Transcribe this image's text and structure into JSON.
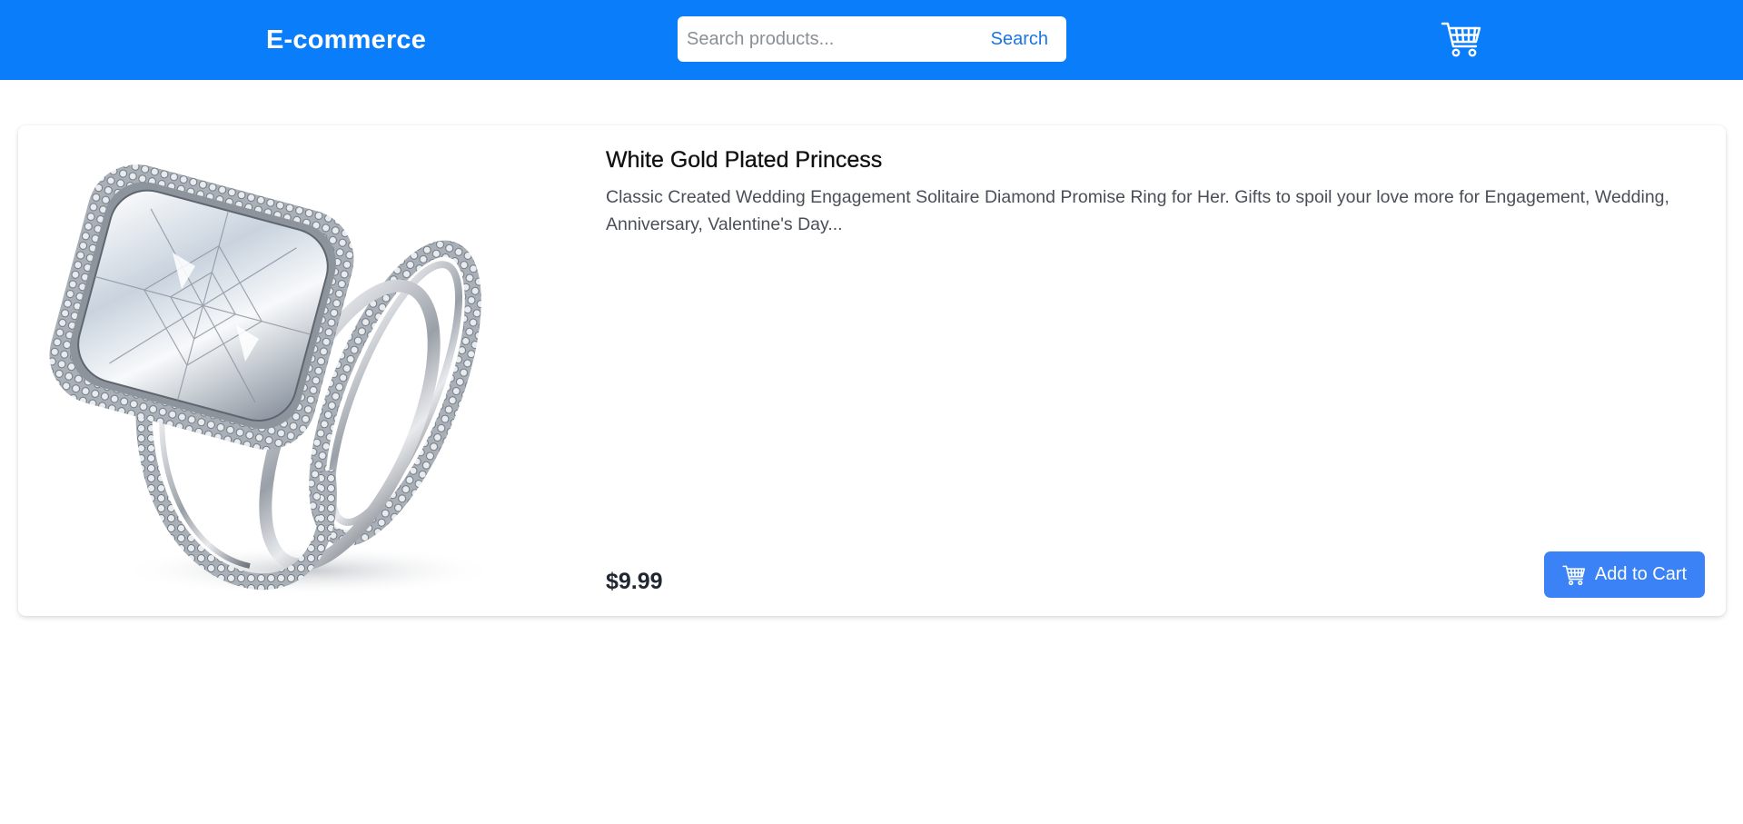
{
  "header": {
    "brand": "E-commerce",
    "search_placeholder": "Search products...",
    "search_label": "Search",
    "cart_icon": "cart-icon"
  },
  "product": {
    "image_icon": "ring-image",
    "title": "White Gold Plated Princess",
    "description": "Classic Created Wedding Engagement Solitaire Diamond Promise Ring for Her. Gifts to spoil your love more for Engagement, Wedding, Anniversary, Valentine's Day...",
    "price": "$9.99",
    "add_to_cart_label": "Add to Cart",
    "add_to_cart_icon": "cart-icon"
  },
  "colors": {
    "header_bg": "#0a7dfb",
    "button_bg": "#3b82f6",
    "search_text": "#1b74e4"
  }
}
